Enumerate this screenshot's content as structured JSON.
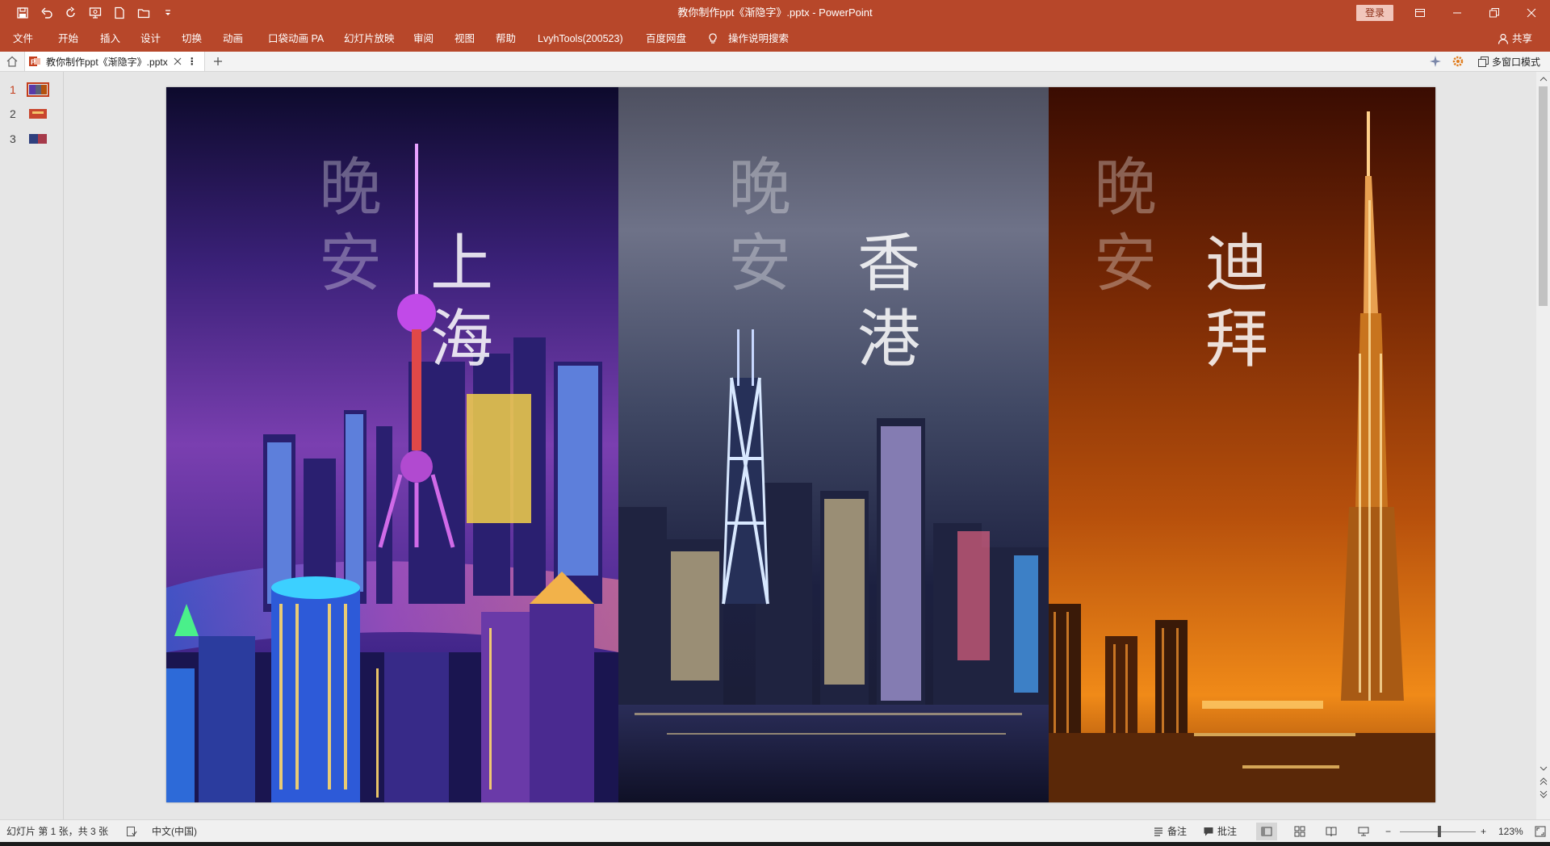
{
  "app": {
    "document_title": "教你制作ppt《渐隐字》.pptx  -  PowerPoint",
    "login_label": "登录"
  },
  "ribbon": {
    "tabs": [
      "文件",
      "开始",
      "插入",
      "设计",
      "切换",
      "动画",
      "口袋动画 PA",
      "幻灯片放映",
      "审阅",
      "视图",
      "帮助",
      "LvyhTools(200523)",
      "百度网盘",
      "操作说明搜索"
    ],
    "share_label": "共享"
  },
  "doc_tabs": {
    "active_tab": "教你制作ppt《渐隐字》.pptx",
    "multi_window_label": "多窗口模式"
  },
  "thumbnails": {
    "slides": [
      "1",
      "2",
      "3"
    ],
    "active": 1
  },
  "slide": {
    "panels": [
      {
        "greeting": [
          "晚",
          "安"
        ],
        "city": [
          "上",
          "海"
        ]
      },
      {
        "greeting": [
          "晚",
          "安"
        ],
        "city": [
          "香",
          "港"
        ]
      },
      {
        "greeting": [
          "晚",
          "安"
        ],
        "city": [
          "迪",
          "拜"
        ]
      }
    ]
  },
  "statusbar": {
    "slide_info": "幻灯片 第 1 张，共 3 张",
    "language": "中文(中国)",
    "notes_label": "备注",
    "comments_label": "批注",
    "zoom": "123%"
  },
  "colors": {
    "accent": "#b7472a",
    "statusbar": "#f0f0f0",
    "workspace": "#e6e6e6"
  }
}
